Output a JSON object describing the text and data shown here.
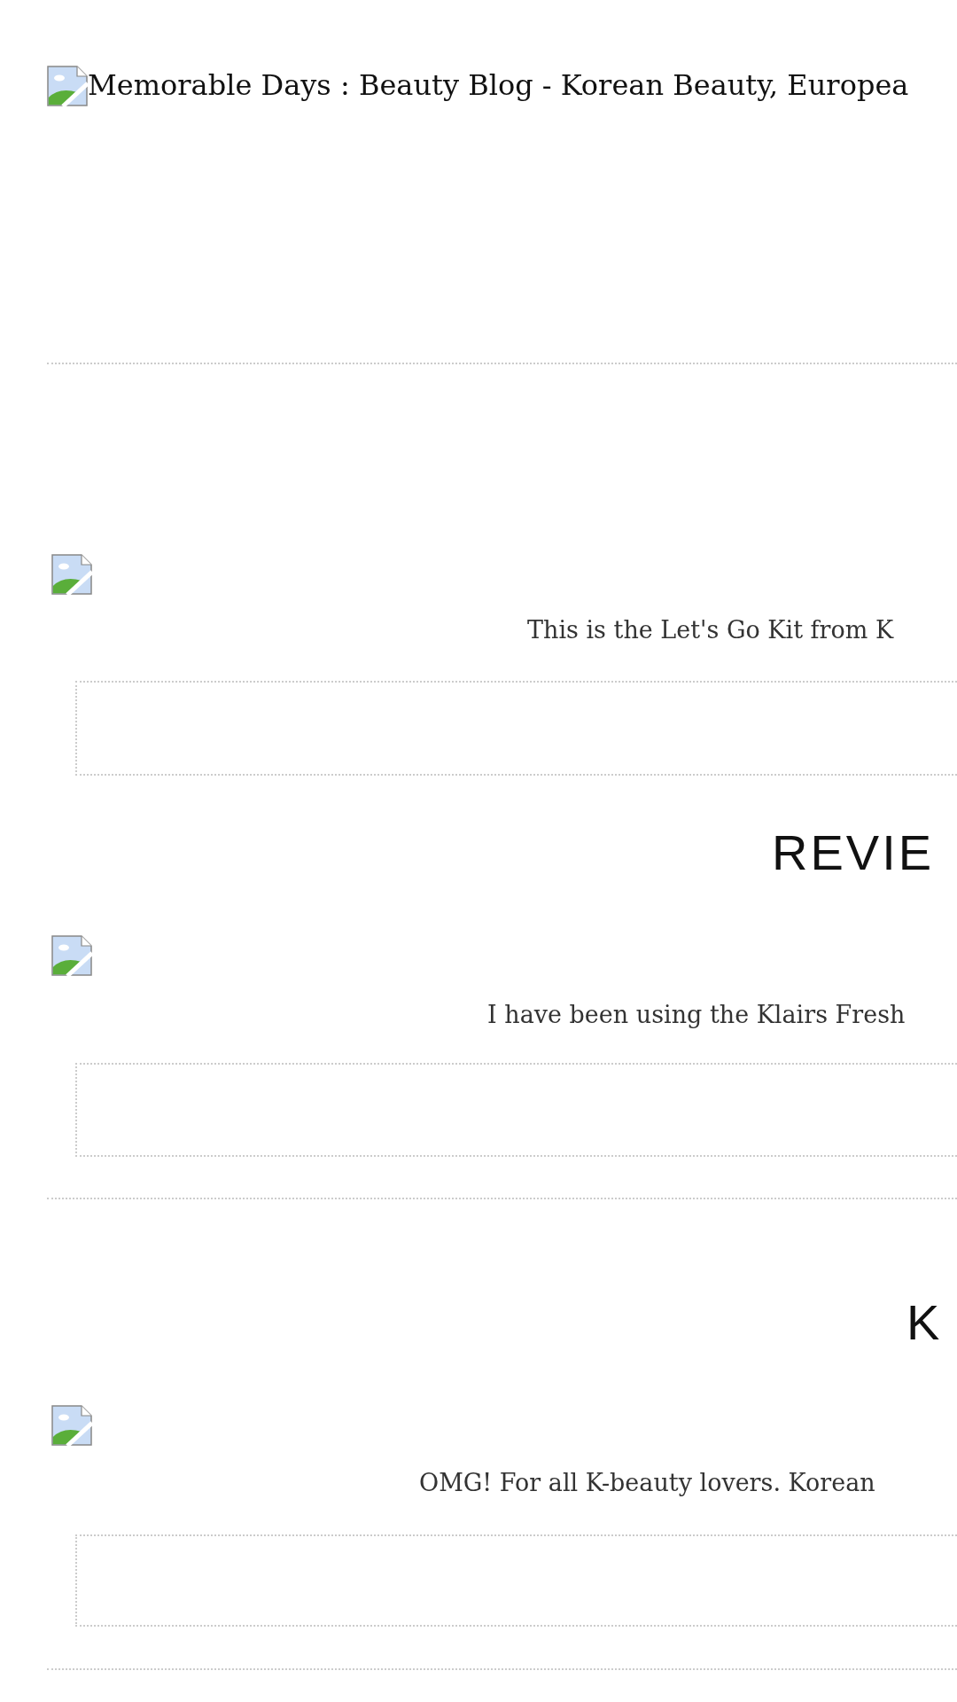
{
  "header": {
    "title": "Memorable Days : Beauty Blog - Korean Beauty, Europea"
  },
  "content": [
    {
      "kind": "divider"
    },
    {
      "kind": "post",
      "excerpt": "This is the Let's Go Kit from K"
    },
    {
      "kind": "heading",
      "text": "REVIE"
    },
    {
      "kind": "post",
      "excerpt": "I have been using the Klairs Fresh"
    },
    {
      "kind": "divider"
    },
    {
      "kind": "heading",
      "text": "K"
    },
    {
      "kind": "post",
      "excerpt": "OMG! For all K-beauty lovers. Korean"
    },
    {
      "kind": "divider"
    }
  ]
}
